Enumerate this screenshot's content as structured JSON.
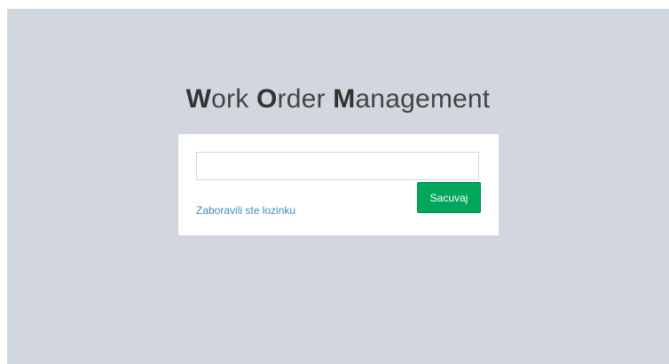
{
  "title": {
    "w_initial": "W",
    "w_rest": "ork ",
    "o_initial": "O",
    "o_rest": "rder ",
    "m_initial": "M",
    "m_rest": "anagement"
  },
  "login": {
    "input_value": "",
    "forgot_password_label": "Zaboravili ste lozinku",
    "save_label": "Sacuvaj"
  },
  "colors": {
    "background": "#d2d6de",
    "panel": "#ffffff",
    "link": "#3c8dbc",
    "button": "#00a65a"
  }
}
